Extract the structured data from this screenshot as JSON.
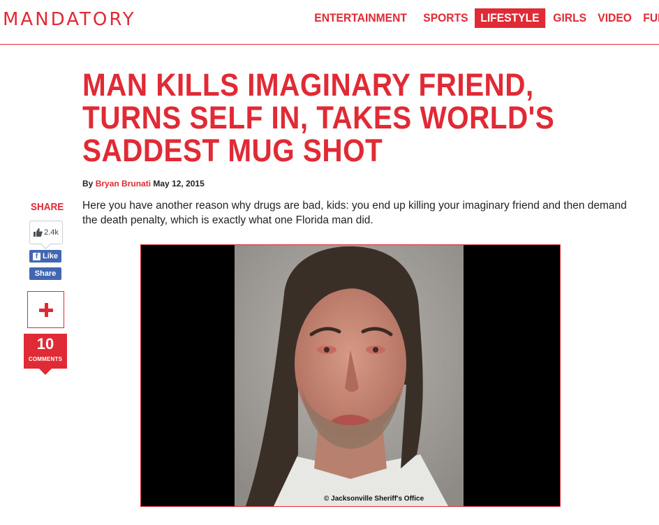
{
  "site": {
    "logo": "MANDATORY",
    "nav": [
      "ENTERTAINMENT",
      "SPORTS",
      "LIFESTYLE",
      "GIRLS",
      "VIDEO",
      "FUNNY"
    ],
    "active_nav": "LIFESTYLE"
  },
  "article": {
    "headline": "MAN KILLS IMAGINARY FRIEND, TURNS SELF IN, TAKES WORLD'S SADDEST MUG SHOT",
    "byline_prefix": "By",
    "author": "Bryan Brunati",
    "date": "May 12, 2015",
    "intro": "Here you have another reason why drugs are bad, kids: you end up killing your imaginary friend and then demand the death penalty, which is exactly what one Florida man did.",
    "image_credit": "Jacksonville Sheriff's Office"
  },
  "share": {
    "title": "SHARE",
    "like_count": "2.4k",
    "like_label": "Like",
    "share_label": "Share",
    "comment_count": "10",
    "comments_label": "COMMENTS"
  },
  "colors": {
    "brand": "#e02a35",
    "facebook": "#4267b2"
  }
}
